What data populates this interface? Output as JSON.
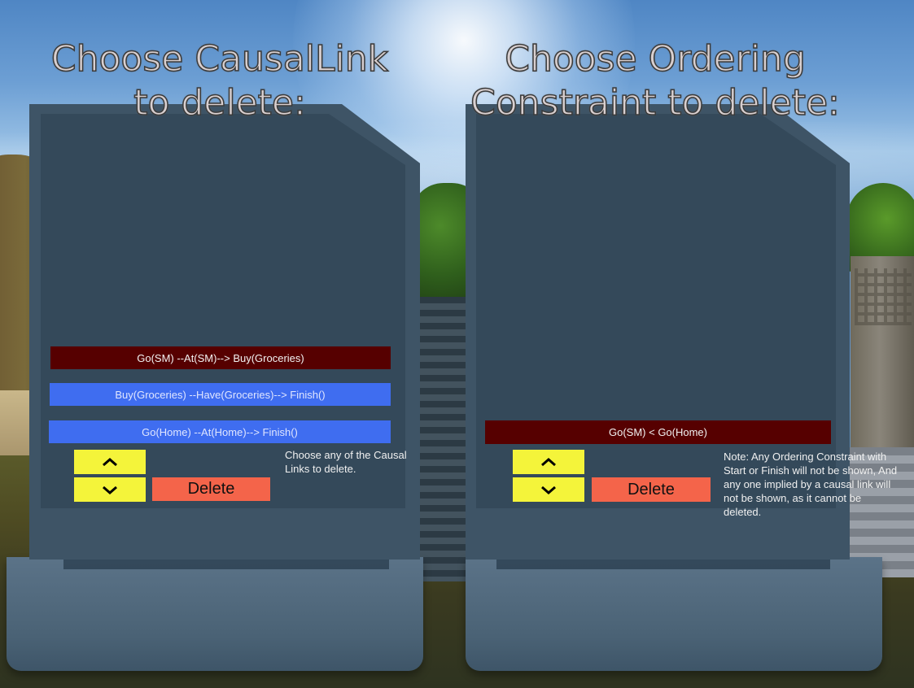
{
  "left_panel": {
    "title_line1": "Choose CausalLink",
    "title_line2": "to delete:",
    "items": [
      {
        "label": "Go(SM) --At(SM)--> Buy(Groceries)",
        "selected": true
      },
      {
        "label": "Buy(Groceries) --Have(Groceries)--> Finish()",
        "selected": false
      },
      {
        "label": "Go(Home) --At(Home)--> Finish()",
        "selected": false
      }
    ],
    "up_icon": "chevron-up-icon",
    "down_icon": "chevron-down-icon",
    "delete_label": "Delete",
    "hint": "Choose any of the Causal Links to delete."
  },
  "right_panel": {
    "title_line1": "Choose Ordering",
    "title_line2": "Constraint to delete:",
    "items": [
      {
        "label": "Go(SM) < Go(Home)",
        "selected": true
      }
    ],
    "up_icon": "chevron-up-icon",
    "down_icon": "chevron-down-icon",
    "delete_label": "Delete",
    "note": "Note: Any Ordering Constraint with Start or Finish will not be shown, And any one implied by a causal link will not be shown, as it cannot be deleted."
  },
  "colors": {
    "selected_item": "#560000",
    "normal_item": "#3f6df0",
    "arrow_button": "#f4f43a",
    "delete_button": "#f4644a",
    "panel": "#3e5466"
  }
}
